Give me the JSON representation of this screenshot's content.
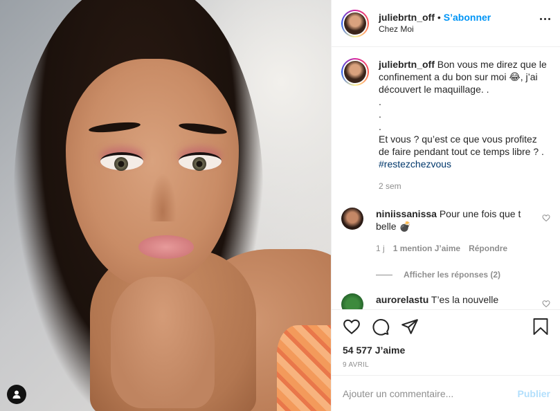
{
  "post": {
    "username": "juliebrtn_off",
    "follow_label": "S’abonner",
    "separator": "•",
    "location": "Chez Moi",
    "caption_user": "juliebrtn_off",
    "caption_text": "Bon vous me direz que le confinement a du bon sur moi 😂, j’ai découvert le maquillage. .",
    "caption_dots": [
      ".",
      ".",
      "."
    ],
    "caption_question": "Et vous ? qu’est ce que vous profitez de faire pendant tout ce temps libre ? .",
    "hashtag": "#restezchezvous",
    "time": "2 sem"
  },
  "comments": [
    {
      "username": "niniissanissa",
      "text": "Pour une fois que t belle 💣",
      "time": "1 j",
      "likes_label": "1 mention J’aime",
      "reply_label": "Répondre",
      "replies_label": "Afficher les réponses (2)"
    },
    {
      "username": "aurorelastu",
      "text": "T’es la nouvelle"
    }
  ],
  "footer": {
    "likes": "54 577 J’aime",
    "date": "9 avril",
    "comment_placeholder": "Ajouter un commentaire...",
    "publish_label": "Publier"
  },
  "icons": [
    "heart-icon",
    "comment-icon",
    "share-icon",
    "bookmark-icon",
    "more-icon",
    "user-tag-icon"
  ]
}
